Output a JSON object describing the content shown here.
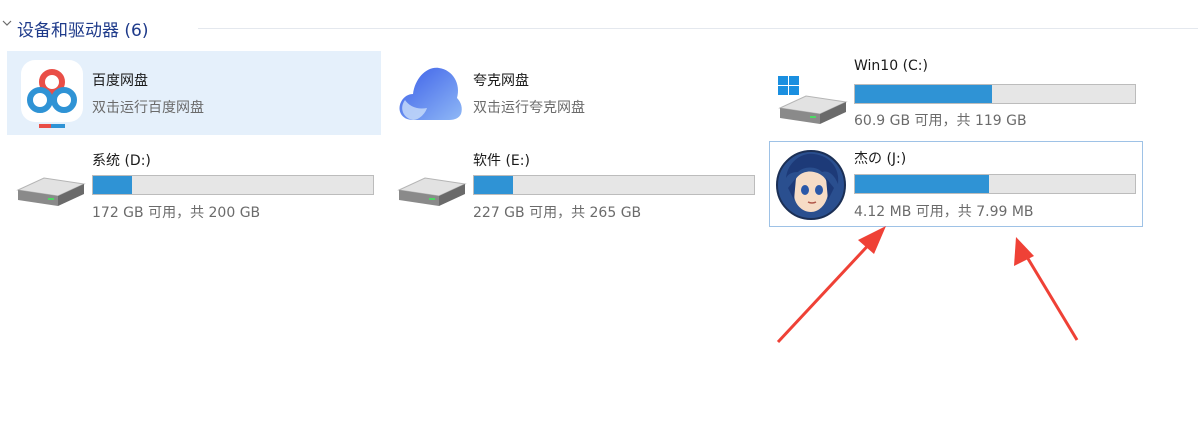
{
  "group": {
    "title": "设备和驱动器 (6)"
  },
  "items": [
    {
      "name": "百度网盘",
      "subtitle": "双击运行百度网盘",
      "icon": "baidu-netdisk-icon"
    },
    {
      "name": "夸克网盘",
      "subtitle": "双击运行夸克网盘",
      "icon": "quark-cloud-icon"
    },
    {
      "name": "Win10 (C:)",
      "space": "60.9 GB 可用，共 119 GB",
      "used_fraction": 0.49,
      "icon": "windows-drive-icon"
    },
    {
      "name": "系统 (D:)",
      "space": "172 GB 可用，共 200 GB",
      "used_fraction": 0.14,
      "icon": "hard-drive-icon"
    },
    {
      "name": "软件 (E:)",
      "space": "227 GB 可用，共 265 GB",
      "used_fraction": 0.14,
      "icon": "hard-drive-icon"
    },
    {
      "name": "杰の (J:)",
      "space": "4.12 MB 可用，共 7.99 MB",
      "used_fraction": 0.48,
      "icon": "anime-avatar-drive-icon"
    }
  ],
  "colors": {
    "accent": "#2f93d5",
    "header": "#1e3a8a",
    "selection_border": "#9ec2e6",
    "hover_bg": "#e5f0fb",
    "annotation_arrow": "#ef4136"
  }
}
